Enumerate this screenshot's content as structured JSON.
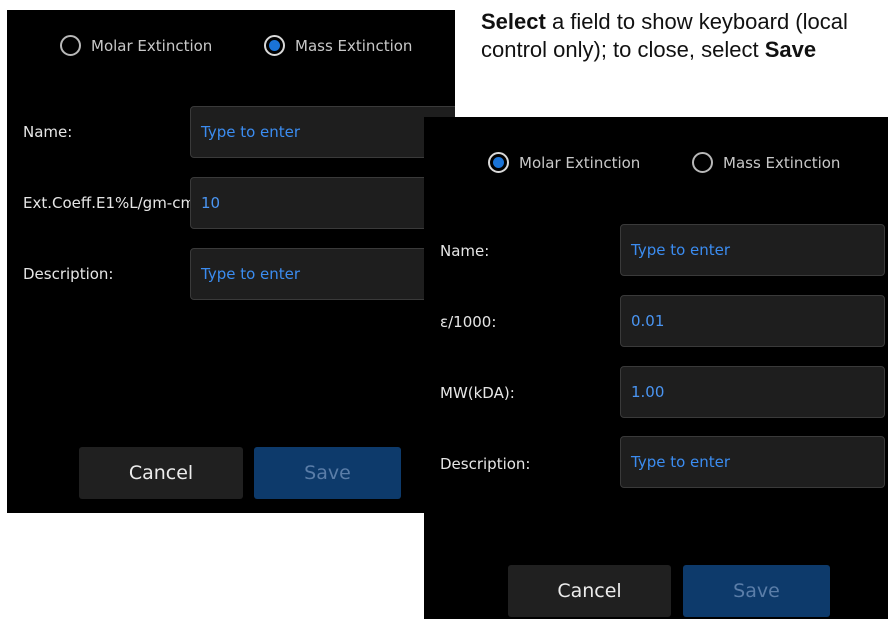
{
  "instructions": {
    "bold1": "Select",
    "text1": " a field to show keyboard (local control only); to close, select ",
    "bold2": "Save"
  },
  "panel_mass": {
    "radio_molar": "Molar Extinction",
    "radio_mass": "Mass Extinction",
    "selected": "mass",
    "fields": [
      {
        "label": "Name:",
        "value": "",
        "placeholder": "Type to enter"
      },
      {
        "label": "Ext.Coeff.E1%L/gm-cm:",
        "value": "10",
        "placeholder": ""
      },
      {
        "label": "Description:",
        "value": "",
        "placeholder": "Type to enter"
      }
    ],
    "cancel": "Cancel",
    "save": "Save"
  },
  "panel_molar": {
    "radio_molar": "Molar Extinction",
    "radio_mass": "Mass Extinction",
    "selected": "molar",
    "fields": [
      {
        "label": "Name:",
        "value": "",
        "placeholder": "Type to enter"
      },
      {
        "label": "ε/1000:",
        "value": "0.01",
        "placeholder": ""
      },
      {
        "label": "MW(kDA):",
        "value": "1.00",
        "placeholder": ""
      },
      {
        "label": "Description:",
        "value": "",
        "placeholder": "Type to enter"
      }
    ],
    "cancel": "Cancel",
    "save": "Save"
  },
  "colors": {
    "panel_bg": "#000000",
    "accent": "#1a73d6",
    "input_text": "#3b8cf0",
    "save_bg": "#0d3a6b"
  }
}
